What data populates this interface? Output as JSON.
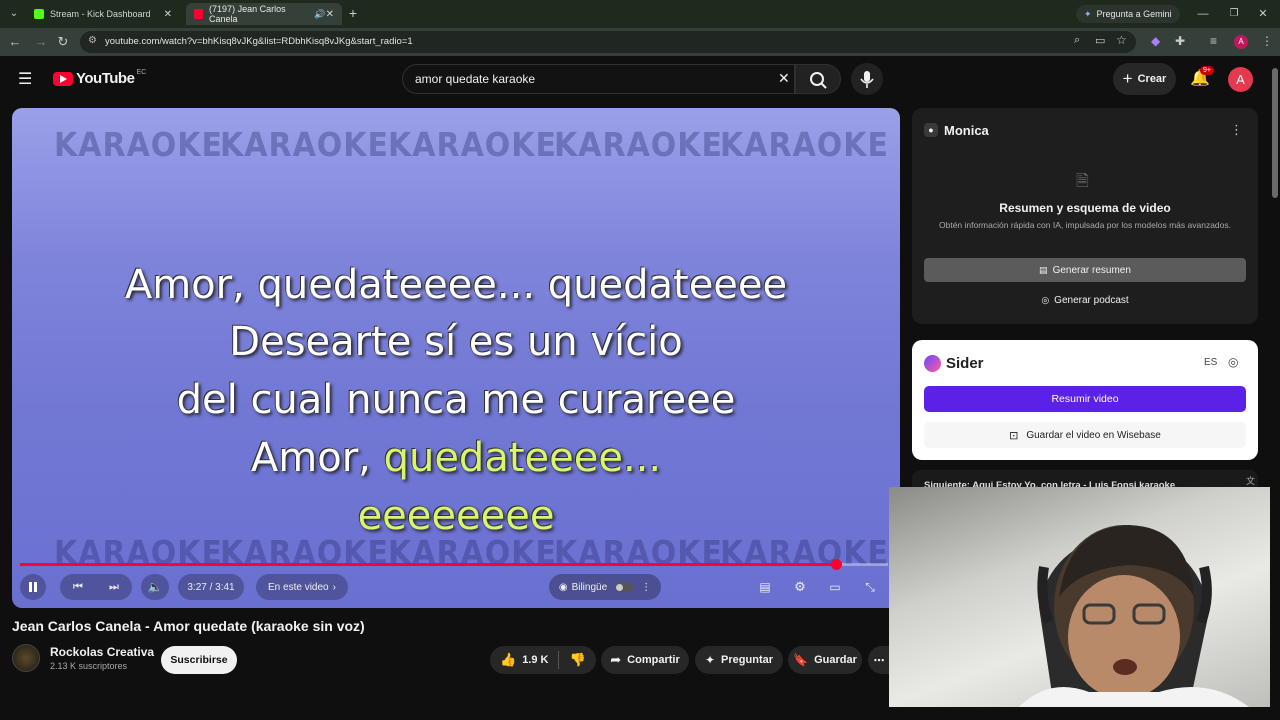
{
  "browser": {
    "tabs": [
      {
        "title": "Stream - Kick Dashboard",
        "color": "#53fc18"
      },
      {
        "title": "(7197) Jean Carlos Canela",
        "color": "#ff0033"
      }
    ],
    "gemini_label": "Pregunta a Gemini",
    "url": "youtube.com/watch?v=bhKisq8vJKg&list=RDbhKisq8vJKg&start_radio=1",
    "profile_initial": "A"
  },
  "youtube": {
    "logo_text": "YouTube",
    "country": "EC",
    "search_value": "amor quedate karaoke",
    "create_label": "Crear",
    "notif_badge": "9+",
    "avatar_initial": "A"
  },
  "video": {
    "watermark": "KARAOKE",
    "lyrics": {
      "line1": "Amor, quedateeee... quedateeee",
      "line2": "Desearte sí es un vício",
      "line3": "del cual nunca me curareee",
      "line4_white": "Amor, ",
      "line4_yellow": "quedateeee...",
      "line5": "eeeeeeee"
    },
    "time": "3:27 / 3:41",
    "progress_fraction": 0.94,
    "chapter_label": "En este video",
    "bilingual_label": "Bilingüe",
    "title": "Jean Carlos Canela - Amor quedate (karaoke sin voz)"
  },
  "channel": {
    "name": "Rockolas Creativa",
    "subscribers": "2.13 K suscriptores",
    "subscribe_label": "Suscribirse"
  },
  "actions": {
    "likes": "1.9 K",
    "share": "Compartir",
    "ask": "Preguntar",
    "save": "Guardar"
  },
  "monica": {
    "name": "Monica",
    "heading": "Resumen y esquema de video",
    "subtext": "Obtén información rápida con IA, impulsada por los modelos más avanzados.",
    "btn_summary": "Generar resumen",
    "btn_podcast": "Generar podcast"
  },
  "sider": {
    "name": "Sider",
    "lang": "ES",
    "btn_summarize": "Resumir video",
    "btn_save": "Guardar el video en Wisebase",
    "accent": "#5b21e6"
  },
  "next_up": "Siguiente: Aqui Estoy Yo, con letra - Luis Fonsi karaoke"
}
